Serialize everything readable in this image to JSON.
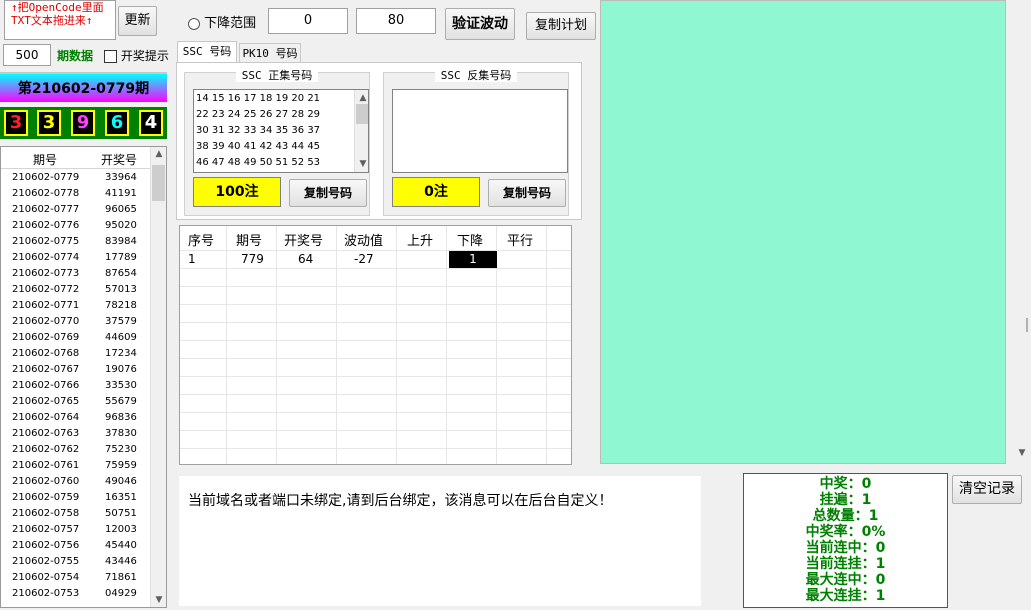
{
  "left": {
    "drop_hint_line1": "↑把OpenCode里面",
    "drop_hint_line2": "TXT文本拖进来↑",
    "update_label": "更新",
    "count_value": "500",
    "period_label": "期数据",
    "alert_label": "开奖提示",
    "current_issue": "第210602-0779期",
    "balls": [
      "3",
      "3",
      "9",
      "6",
      "4"
    ],
    "ball_colors": [
      "#ff2020",
      "#ffff00",
      "#ff40ff",
      "#00ffff",
      "#ffffff"
    ],
    "history_headers": [
      "期号",
      "开奖号"
    ],
    "history": [
      [
        "210602-0779",
        "33964"
      ],
      [
        "210602-0778",
        "41191"
      ],
      [
        "210602-0777",
        "96065"
      ],
      [
        "210602-0776",
        "95020"
      ],
      [
        "210602-0775",
        "83984"
      ],
      [
        "210602-0774",
        "17789"
      ],
      [
        "210602-0773",
        "87654"
      ],
      [
        "210602-0772",
        "57013"
      ],
      [
        "210602-0771",
        "78218"
      ],
      [
        "210602-0770",
        "37579"
      ],
      [
        "210602-0769",
        "44609"
      ],
      [
        "210602-0768",
        "17234"
      ],
      [
        "210602-0767",
        "19076"
      ],
      [
        "210602-0766",
        "33530"
      ],
      [
        "210602-0765",
        "55679"
      ],
      [
        "210602-0764",
        "96836"
      ],
      [
        "210602-0763",
        "37830"
      ],
      [
        "210602-0762",
        "75230"
      ],
      [
        "210602-0761",
        "75959"
      ],
      [
        "210602-0760",
        "49046"
      ],
      [
        "210602-0759",
        "16351"
      ],
      [
        "210602-0758",
        "50751"
      ],
      [
        "210602-0757",
        "12003"
      ],
      [
        "210602-0756",
        "45440"
      ],
      [
        "210602-0755",
        "43446"
      ],
      [
        "210602-0754",
        "71861"
      ],
      [
        "210602-0753",
        "04929"
      ]
    ]
  },
  "controls": {
    "drop_range_label": "下降范围",
    "range_min": "0",
    "range_max": "80",
    "verify_label": "验证波动",
    "copy_plan_label": "复制计划"
  },
  "tabs": [
    "SSC 号码",
    "PK10 号码"
  ],
  "positive": {
    "title": "SSC 正集号码",
    "numbers": [
      "14 15 16 17 18 19 20 21",
      "22 23 24 25 26 27 28 29",
      "30 31 32 33 34 35 36 37",
      "38 39 40 41 42 43 44 45",
      "46 47 48 49 50 51 52 53"
    ],
    "count": "100注",
    "copy_label": "复制号码"
  },
  "negative": {
    "title": "SSC 反集号码",
    "count": "0注",
    "copy_label": "复制号码"
  },
  "grid": {
    "headers": [
      "序号",
      "期号",
      "开奖号",
      "波动值",
      "上升",
      "下降",
      "平行"
    ],
    "row": [
      "1",
      "779",
      "64",
      "-27",
      "",
      "1",
      ""
    ]
  },
  "message": "当前域名或者端口未绑定,请到后台绑定，该消息可以在后台自定义！",
  "stats": [
    "中奖：0",
    "挂遍：1",
    "总数量：1",
    "中奖率：0%",
    "当前连中：0",
    "当前连挂：1",
    "最大连中：0",
    "最大连挂：1"
  ],
  "clear_label": "清空记录"
}
